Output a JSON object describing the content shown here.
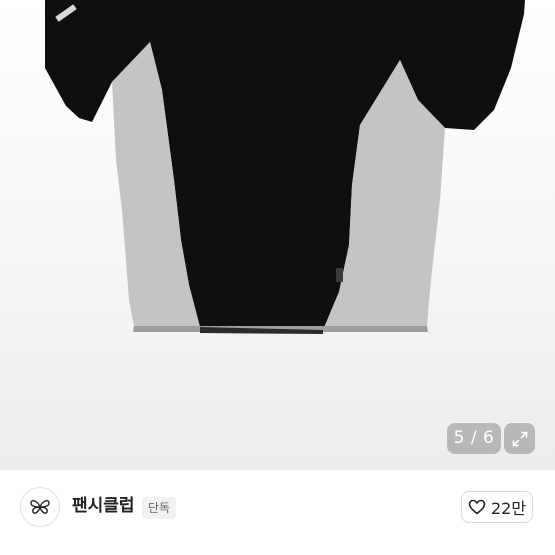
{
  "gallery": {
    "counter": "5 / 6",
    "expand_icon": "expand-icon"
  },
  "shop": {
    "logo_icon": "butterfly-logo-icon",
    "name": "팬시클럽",
    "badge": "단독",
    "like_icon": "heart-icon",
    "like_count": "22만"
  },
  "colors": {
    "shirt_body": "#0f0f0f",
    "shirt_panel": "#c4c4c6",
    "background": "#ffffff"
  }
}
